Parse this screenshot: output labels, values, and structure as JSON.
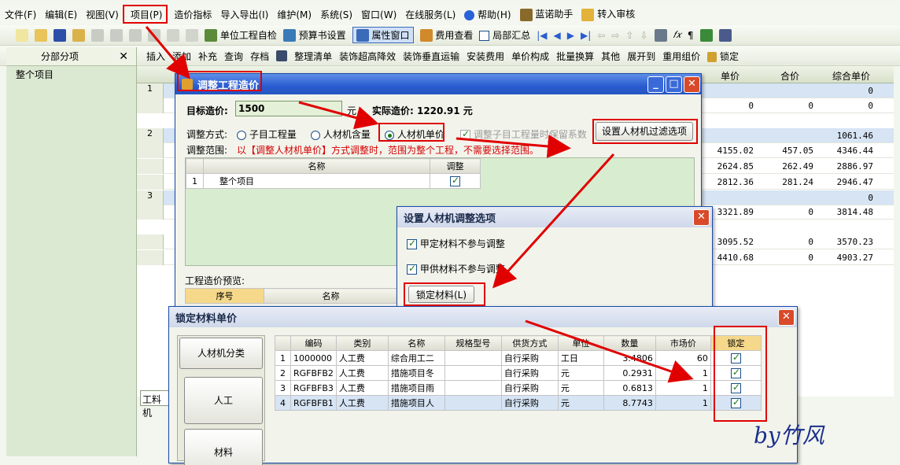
{
  "menu": [
    "文件(F)",
    "编辑(E)",
    "视图(V)",
    "项目(P)",
    "造价指标",
    "导入导出(I)",
    "维护(M)",
    "系统(S)",
    "窗口(W)",
    "在线服务(L)",
    "帮助(H)",
    "蓝诺助手",
    "转入审核"
  ],
  "toolbar1": {
    "unit_check": "单位工程自检",
    "budget_settings": "预算书设置",
    "properties_window": "属性窗口",
    "fee_view": "费用查看",
    "partial_summary": "局部汇总"
  },
  "toolbar2": [
    "插入",
    "添加",
    "补充",
    "查询",
    "存档",
    "整理清单",
    "装饰超高降效",
    "装饰垂直运输",
    "安装费用",
    "单价构成",
    "批量换算",
    "其他",
    "展开到",
    "重用组价",
    "锁定"
  ],
  "left_panel": {
    "title": "分部分项",
    "close": "✕",
    "item": "整个项目"
  },
  "grid": {
    "headers": [
      "单价",
      "合价",
      "综合单价"
    ],
    "rows": [
      {
        "num": "1",
        "v": [
          "",
          "",
          "0"
        ]
      },
      {
        "num": "",
        "v": [
          "0",
          "0",
          "0"
        ]
      },
      {
        "num": "2",
        "v": [
          "",
          "",
          "1061.46"
        ]
      },
      {
        "num": "",
        "v": [
          "4155.02",
          "457.05",
          "4346.44"
        ]
      },
      {
        "num": "",
        "v": [
          "2624.85",
          "262.49",
          "2886.97"
        ]
      },
      {
        "num": "",
        "v": [
          "2812.36",
          "281.24",
          "2946.47"
        ]
      },
      {
        "num": "3",
        "v": [
          "",
          "",
          "0"
        ]
      },
      {
        "num": "",
        "v": [
          "3321.89",
          "0",
          "3814.48"
        ]
      },
      {
        "num": "",
        "v": [
          "3095.52",
          "0",
          "3570.23"
        ]
      },
      {
        "num": "",
        "v": [
          "4410.68",
          "0",
          "4903.27"
        ]
      }
    ],
    "bottom_tab": "工料机"
  },
  "adjust_dialog": {
    "title": "调整工程造价",
    "target_label": "目标造价:",
    "target_value": "1500",
    "yuan": "元，",
    "actual_label": "实际造价: 1220.91 元",
    "mode_label": "调整方式:",
    "mode_options": [
      "子目工程量",
      "人材机含量",
      "人材机单价"
    ],
    "keep_coef": "调整子目工程量时保留系数",
    "filter_button": "设置人材机过滤选项",
    "range_label": "调整范围:",
    "range_note": "以【调整人材机单价】方式调整时，范围为整个工程，不需要选择范围。",
    "table_headers": [
      "名称",
      "调整"
    ],
    "table_rows": [
      {
        "num": "1",
        "name": "整个项目"
      }
    ],
    "preview_label": "工程造价预览:",
    "preview_headers": [
      "序号",
      "名称"
    ]
  },
  "options_dialog": {
    "title": "设置人材机调整选项",
    "opt1": "甲定材料不参与调整",
    "opt2": "甲供材料不参与调整",
    "lock_button": "锁定材料(L)"
  },
  "lock_dialog": {
    "title": "锁定材料单价",
    "categories": [
      "人材机分类",
      "人工",
      "材料"
    ],
    "headers": [
      "",
      "编码",
      "类别",
      "名称",
      "规格型号",
      "供货方式",
      "单位",
      "数量",
      "市场价",
      "锁定"
    ],
    "rows": [
      {
        "n": "1",
        "code": "1000000",
        "cat": "人工费",
        "name": "综合用工二",
        "spec": "",
        "supply": "自行采购",
        "unit": "工日",
        "qty": "3.4806",
        "price": "60"
      },
      {
        "n": "2",
        "code": "RGFBFB2",
        "cat": "人工费",
        "name": "措施项目冬",
        "spec": "",
        "supply": "自行采购",
        "unit": "元",
        "qty": "0.2931",
        "price": "1"
      },
      {
        "n": "3",
        "code": "RGFBFB3",
        "cat": "人工费",
        "name": "措施项目雨",
        "spec": "",
        "supply": "自行采购",
        "unit": "元",
        "qty": "0.6813",
        "price": "1"
      },
      {
        "n": "4",
        "code": "RGFBFB1",
        "cat": "人工费",
        "name": "措施项目人",
        "spec": "",
        "supply": "自行采购",
        "unit": "元",
        "qty": "8.7743",
        "price": "1"
      }
    ]
  },
  "signature": "by竹风"
}
